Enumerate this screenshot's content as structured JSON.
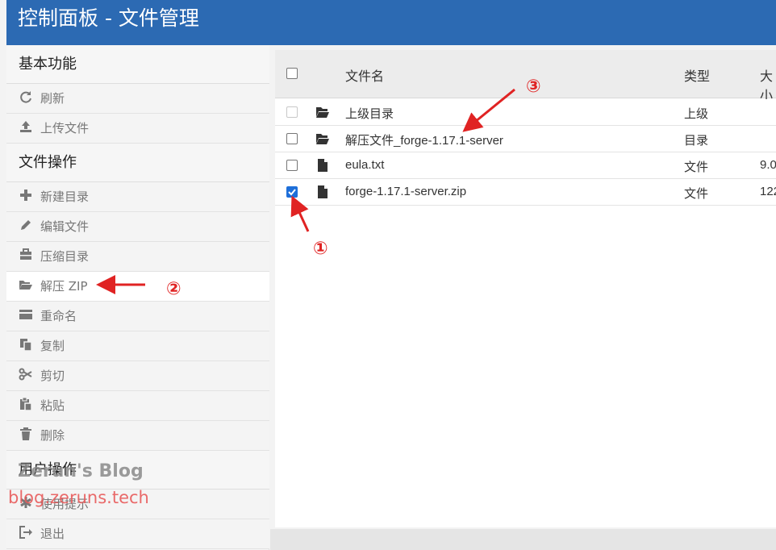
{
  "header": {
    "title": "控制面板 - 文件管理"
  },
  "sidebar": {
    "sections": [
      {
        "label": "基本功能"
      },
      {
        "label": "文件操作"
      },
      {
        "label": "用户操作"
      }
    ],
    "items": [
      {
        "label": "刷新",
        "icon": "refresh-icon"
      },
      {
        "label": "上传文件",
        "icon": "upload-icon"
      },
      {
        "label": "新建目录",
        "icon": "plus-icon"
      },
      {
        "label": "编辑文件",
        "icon": "pencil-icon"
      },
      {
        "label": "压缩目录",
        "icon": "briefcase-icon"
      },
      {
        "label": "解压 ZIP",
        "icon": "open-folder-icon"
      },
      {
        "label": "重命名",
        "icon": "card-icon"
      },
      {
        "label": "复制",
        "icon": "copy-icon"
      },
      {
        "label": "剪切",
        "icon": "scissors-icon"
      },
      {
        "label": "粘贴",
        "icon": "paste-icon"
      },
      {
        "label": "删除",
        "icon": "trash-icon"
      },
      {
        "label": "使用提示",
        "icon": "asterisk-icon"
      },
      {
        "label": "退出",
        "icon": "logout-icon"
      }
    ]
  },
  "table": {
    "columns": [
      "文件名",
      "类型",
      "大小"
    ],
    "rows": [
      {
        "name": "上级目录",
        "type": "上级",
        "size": "",
        "icon": "open-folder-icon",
        "checked": false,
        "disabled": true
      },
      {
        "name": "解压文件_forge-1.17.1-server",
        "type": "目录",
        "size": "",
        "icon": "open-folder-icon",
        "checked": false,
        "disabled": false
      },
      {
        "name": "eula.txt",
        "type": "文件",
        "size": "9.0",
        "icon": "file-icon",
        "checked": false,
        "disabled": false
      },
      {
        "name": "forge-1.17.1-server.zip",
        "type": "文件",
        "size": "122",
        "icon": "file-icon",
        "checked": true,
        "disabled": false
      }
    ]
  },
  "annotations": {
    "a1": "①",
    "a2": "②",
    "a3": "③"
  },
  "watermark": {
    "line1": "Zerun's Blog",
    "line2": "blog.zeruns.tech"
  },
  "colors": {
    "header": "#2c6ab3",
    "annotation": "#e02323",
    "checkbox": "#1e6fd9"
  }
}
